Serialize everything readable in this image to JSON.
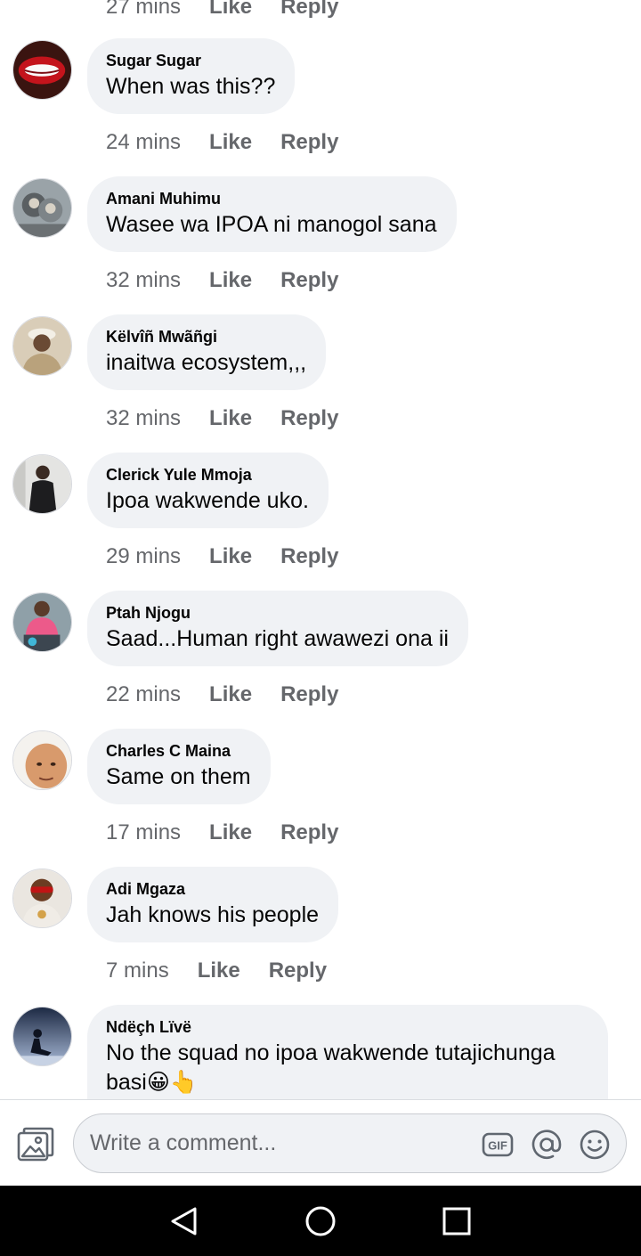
{
  "previous_comment": {
    "time": "27 mins",
    "like_label": "Like",
    "reply_label": "Reply"
  },
  "comments": [
    {
      "author": "Sugar Sugar",
      "text": "When was this??",
      "time": "24 mins",
      "like_label": "Like",
      "reply_label": "Reply",
      "avatar": "avatar-lips"
    },
    {
      "author": "Amani Muhimu",
      "text": "Wasee wa IPOA ni manogol sana",
      "time": "32 mins",
      "like_label": "Like",
      "reply_label": "Reply",
      "avatar": "avatar-monkey"
    },
    {
      "author": "Këlvîñ Mwãñgi",
      "text": "inaitwa ecosystem,,,",
      "time": "32 mins",
      "like_label": "Like",
      "reply_label": "Reply",
      "avatar": "avatar-man-cap"
    },
    {
      "author": "Clerick Yule Mmoja",
      "text": "Ipoa wakwende uko.",
      "time": "29 mins",
      "like_label": "Like",
      "reply_label": "Reply",
      "avatar": "avatar-man-suit"
    },
    {
      "author": "Ptah Njogu",
      "text": "Saad...Human right awawezi ona ii",
      "time": "22 mins",
      "like_label": "Like",
      "reply_label": "Reply",
      "avatar": "avatar-man-pink"
    },
    {
      "author": "Charles C Maina",
      "text": "Same on them",
      "time": "17 mins",
      "like_label": "Like",
      "reply_label": "Reply",
      "avatar": "avatar-face"
    },
    {
      "author": "Adi Mgaza",
      "text": "Jah knows his people",
      "time": "7 mins",
      "like_label": "Like",
      "reply_label": "Reply",
      "avatar": "avatar-man-glasses"
    },
    {
      "author": "Ndëçh Lïvë",
      "text": "No the squad no ipoa wakwende tutajichunga",
      "text2": "basi😀👆",
      "avatar": "avatar-silhouette"
    }
  ],
  "composer": {
    "placeholder": "Write a comment...",
    "photo_icon": "photo-icon",
    "gif_label": "GIF",
    "mention_icon": "at-icon",
    "emoji_icon": "smiley-icon"
  },
  "navbar": {
    "back_icon": "back-triangle-icon",
    "home_icon": "home-circle-icon",
    "recents_icon": "recents-square-icon"
  },
  "colors": {
    "bubble": "#f0f2f5",
    "meta_text": "#65676b",
    "text": "#050505",
    "navbar": "#000000"
  }
}
